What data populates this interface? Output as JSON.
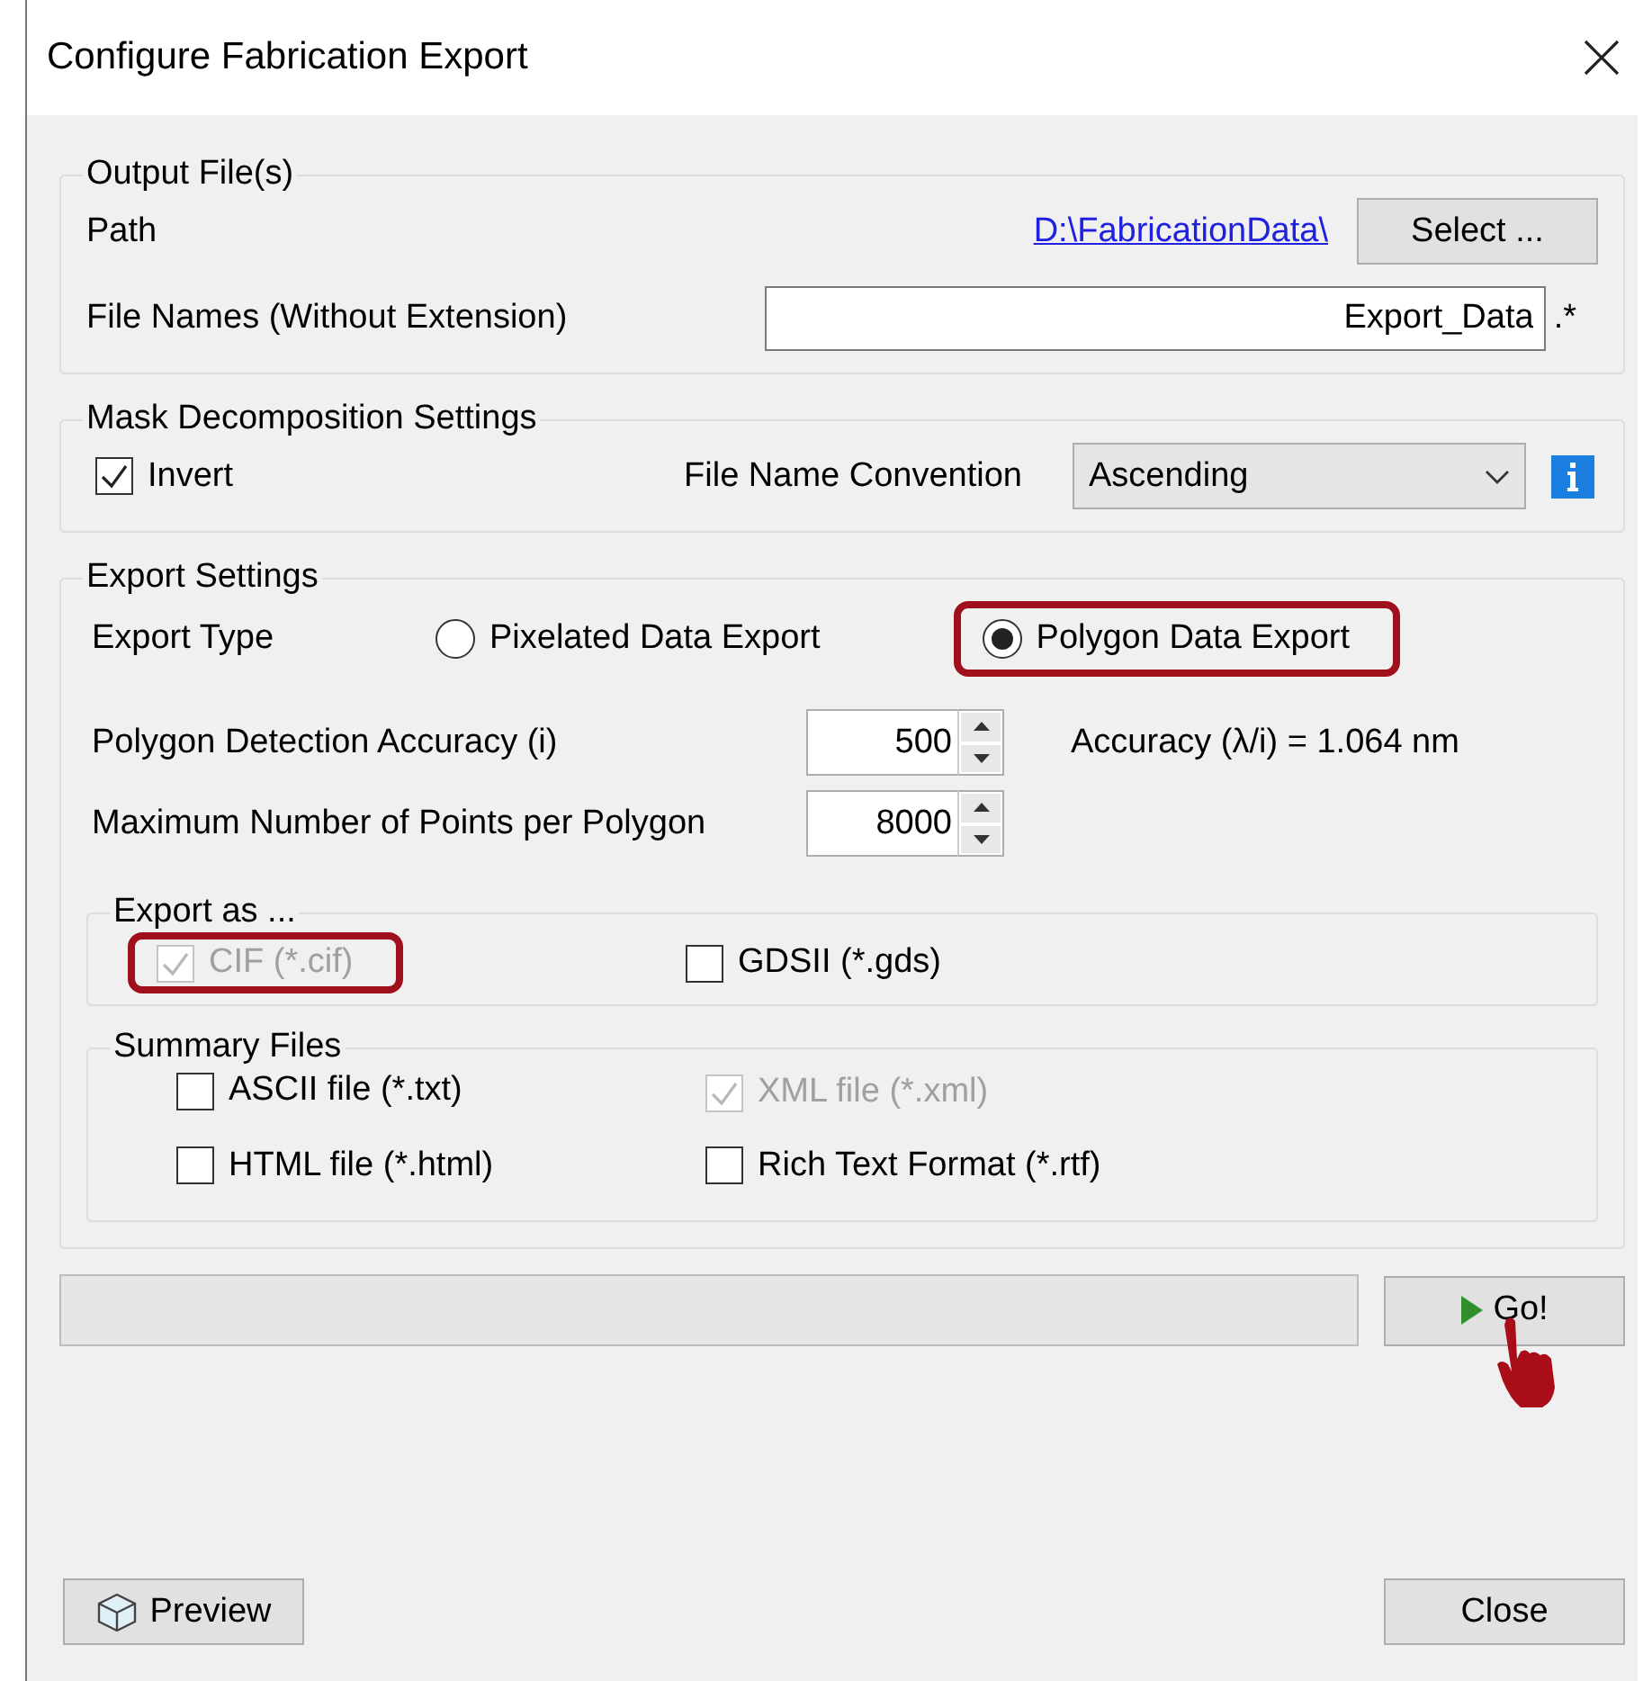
{
  "window": {
    "title": "Configure Fabrication Export"
  },
  "output_files": {
    "legend": "Output File(s)",
    "path_label": "Path",
    "path_link": "D:\\FabricationData\\",
    "select_button": "Select ...",
    "file_names_label": "File Names (Without Extension)",
    "file_names_value": "Export_Data",
    "extension": ".*"
  },
  "mask": {
    "legend": "Mask Decomposition Settings",
    "invert": {
      "label": "Invert",
      "checked": true
    },
    "convention_label": "File Name Convention",
    "convention_value": "Ascending"
  },
  "export_settings": {
    "legend": "Export Settings",
    "type_label": "Export Type",
    "types": [
      {
        "label": "Pixelated Data Export",
        "selected": false,
        "highlighted": false
      },
      {
        "label": "Polygon Data Export",
        "selected": true,
        "highlighted": true
      }
    ],
    "accuracy_label": "Polygon Detection Accuracy (i)",
    "accuracy_value": "500",
    "accuracy_result": "Accuracy (λ/i) = 1.064 nm",
    "max_points_label": "Maximum Number of Points per Polygon",
    "max_points_value": "8000",
    "export_as": {
      "legend": "Export as ...",
      "options": [
        {
          "label": "CIF (*.cif)",
          "checked": true,
          "disabled": true,
          "highlighted": true
        },
        {
          "label": "GDSII (*.gds)",
          "checked": false,
          "disabled": false,
          "highlighted": false
        }
      ]
    },
    "summary": {
      "legend": "Summary Files",
      "options": [
        {
          "label": "ASCII file (*.txt)",
          "checked": false,
          "disabled": false
        },
        {
          "label": "XML file (*.xml)",
          "checked": true,
          "disabled": true
        },
        {
          "label": "HTML file (*.html)",
          "checked": false,
          "disabled": false
        },
        {
          "label": "Rich Text Format (*.rtf)",
          "checked": false,
          "disabled": false
        }
      ]
    }
  },
  "progress": {
    "level": 0
  },
  "go_button": "Go!",
  "preview_button": "Preview",
  "close_button": "Close"
}
